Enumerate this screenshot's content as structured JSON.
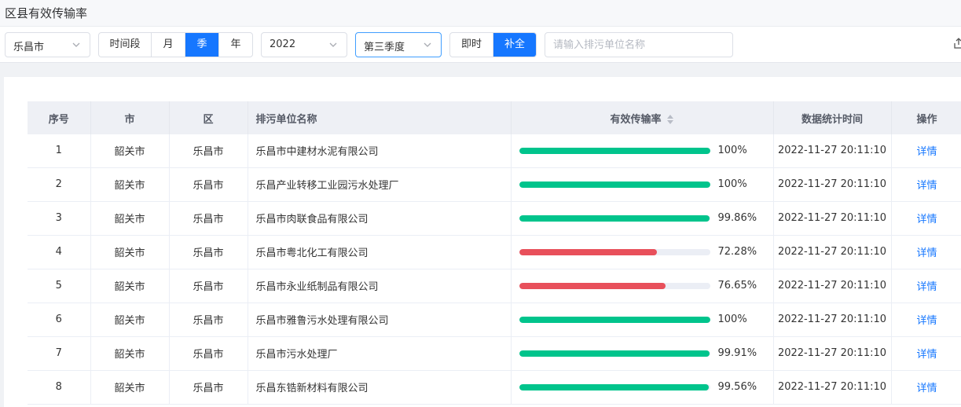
{
  "header": {
    "title": "区县有效传输率"
  },
  "toolbar": {
    "city_select": "乐昌市",
    "period_label": "时间段",
    "month_label": "月",
    "season_label": "季",
    "year_label": "年",
    "year_select": "2022",
    "quarter_select": "第三季度",
    "realtime_label": "即时",
    "complete_label": "补全",
    "search_placeholder": "请输入排污单位名称"
  },
  "table": {
    "columns": [
      "序号",
      "市",
      "区",
      "排污单位名称",
      "有效传输率",
      "数据统计时间",
      "操作"
    ],
    "rows": [
      {
        "index": "1",
        "city": "韶关市",
        "district": "乐昌市",
        "name": "乐昌市中建材水泥有限公司",
        "rate": 100,
        "rate_text": "100%",
        "status": "good",
        "time": "2022-11-27 20:11:10",
        "action": "详情"
      },
      {
        "index": "2",
        "city": "韶关市",
        "district": "乐昌市",
        "name": "乐昌产业转移工业园污水处理厂",
        "rate": 100,
        "rate_text": "100%",
        "status": "good",
        "time": "2022-11-27 20:11:10",
        "action": "详情"
      },
      {
        "index": "3",
        "city": "韶关市",
        "district": "乐昌市",
        "name": "乐昌市肉联食品有限公司",
        "rate": 99.86,
        "rate_text": "99.86%",
        "status": "good",
        "time": "2022-11-27 20:11:10",
        "action": "详情"
      },
      {
        "index": "4",
        "city": "韶关市",
        "district": "乐昌市",
        "name": "乐昌市粤北化工有限公司",
        "rate": 72.28,
        "rate_text": "72.28%",
        "status": "bad",
        "time": "2022-11-27 20:11:10",
        "action": "详情"
      },
      {
        "index": "5",
        "city": "韶关市",
        "district": "乐昌市",
        "name": "乐昌市永业纸制品有限公司",
        "rate": 76.65,
        "rate_text": "76.65%",
        "status": "bad",
        "time": "2022-11-27 20:11:10",
        "action": "详情"
      },
      {
        "index": "6",
        "city": "韶关市",
        "district": "乐昌市",
        "name": "乐昌市雅鲁污水处理有限公司",
        "rate": 100,
        "rate_text": "100%",
        "status": "good",
        "time": "2022-11-27 20:11:10",
        "action": "详情"
      },
      {
        "index": "7",
        "city": "韶关市",
        "district": "乐昌市",
        "name": "乐昌市污水处理厂",
        "rate": 99.91,
        "rate_text": "99.91%",
        "status": "good",
        "time": "2022-11-27 20:11:10",
        "action": "详情"
      },
      {
        "index": "8",
        "city": "韶关市",
        "district": "乐昌市",
        "name": "乐昌东锆新材料有限公司",
        "rate": 99.56,
        "rate_text": "99.56%",
        "status": "good",
        "time": "2022-11-27 20:11:10",
        "action": "详情"
      }
    ]
  },
  "colors": {
    "good": "#00c48c",
    "bad": "#e8505b",
    "accent": "#1677ff"
  },
  "icons": {
    "select_arrow": "chevron-down-icon",
    "sort": "sort-icon",
    "export": "export-icon"
  }
}
